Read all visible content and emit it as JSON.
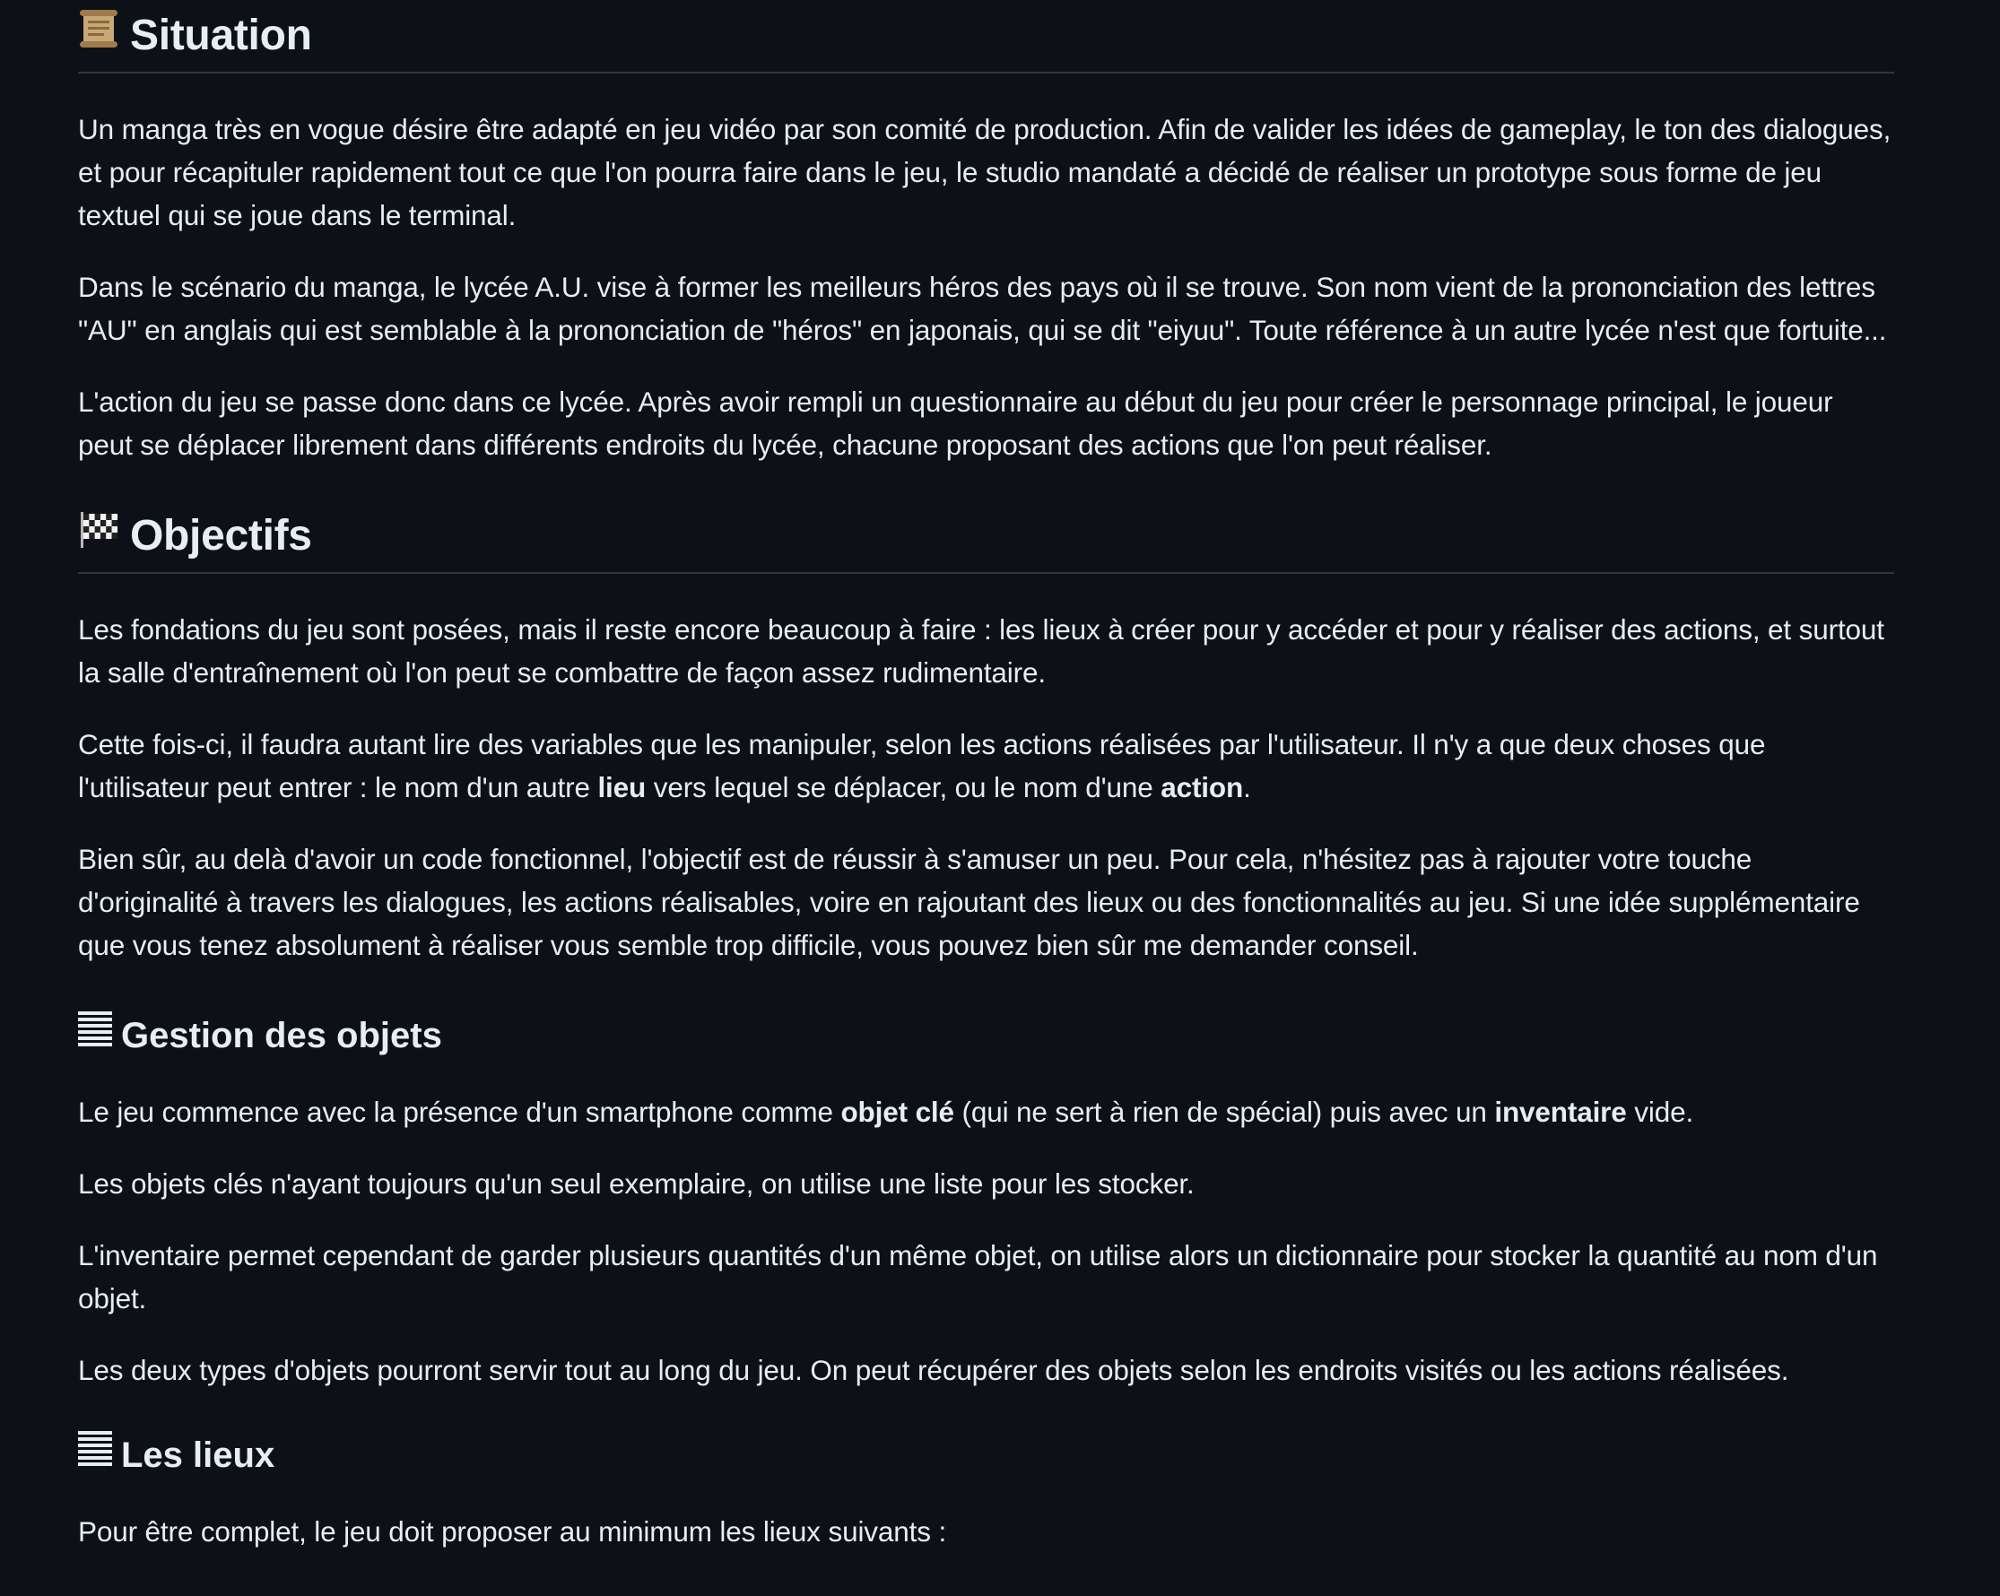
{
  "sections": {
    "situation": {
      "heading": "Situation",
      "icon": "scroll-icon",
      "paragraphs": [
        "Un manga très en vogue désire être adapté en jeu vidéo par son comité de production. Afin de valider les idées de gameplay, le ton des dialogues, et pour récapituler rapidement tout ce que l'on pourra faire dans le jeu, le studio mandaté a décidé de réaliser un prototype sous forme de jeu textuel qui se joue dans le terminal.",
        "Dans le scénario du manga, le lycée A.U. vise à former les meilleurs héros des pays où il se trouve. Son nom vient de la prononciation des lettres \"AU\" en anglais qui est semblable à la prononciation de \"héros\" en japonais, qui se dit \"eiyuu\". Toute référence à un autre lycée n'est que fortuite...",
        "L'action du jeu se passe donc dans ce lycée. Après avoir rempli un questionnaire au début du jeu pour créer le personnage principal, le joueur peut se déplacer librement dans différents endroits du lycée, chacune proposant des actions que l'on peut réaliser."
      ]
    },
    "objectifs": {
      "heading": "Objectifs",
      "icon": "chequered-flag-icon",
      "p1": "Les fondations du jeu sont posées, mais il reste encore beaucoup à faire : les lieux à créer pour y accéder et pour y réaliser des actions, et surtout la salle d'entraînement où l'on peut se combattre de façon assez rudimentaire.",
      "p2_a": "Cette fois-ci, il faudra autant lire des variables que les manipuler, selon les actions réalisées par l'utilisateur. Il n'y a que deux choses que l'utilisateur peut entrer : le nom d'un autre ",
      "p2_b": "lieu",
      "p2_c": " vers lequel se déplacer, ou le nom d'une ",
      "p2_d": "action",
      "p2_e": ".",
      "p3": "Bien sûr, au delà d'avoir un code fonctionnel, l'objectif est de réussir à s'amuser un peu. Pour cela, n'hésitez pas à rajouter votre touche d'originalité à travers les dialogues, les actions réalisables, voire en rajoutant des lieux ou des fonctionnalités au jeu. Si une idée supplémentaire que vous tenez absolument à réaliser vous semble trop difficile, vous pouvez bien sûr me demander conseil."
    },
    "gestion": {
      "heading": "Gestion des objets",
      "icon": "text-lines-icon",
      "p1_a": "Le jeu commence avec la présence d'un smartphone comme ",
      "p1_b": "objet clé",
      "p1_c": " (qui ne sert à rien de spécial) puis avec un ",
      "p1_d": "inventaire",
      "p1_e": " vide.",
      "p2": "Les objets clés n'ayant toujours qu'un seul exemplaire, on utilise une liste pour les stocker.",
      "p3": "L'inventaire permet cependant de garder plusieurs quantités d'un même objet, on utilise alors un dictionnaire pour stocker la quantité au nom d'un objet.",
      "p4": "Les deux types d'objets pourront servir tout au long du jeu. On peut récupérer des objets selon les endroits visités ou les actions réalisées."
    },
    "lieux": {
      "heading": "Les lieux",
      "icon": "text-lines-icon",
      "p1": "Pour être complet, le jeu doit proposer au minimum les lieux suivants :"
    }
  }
}
